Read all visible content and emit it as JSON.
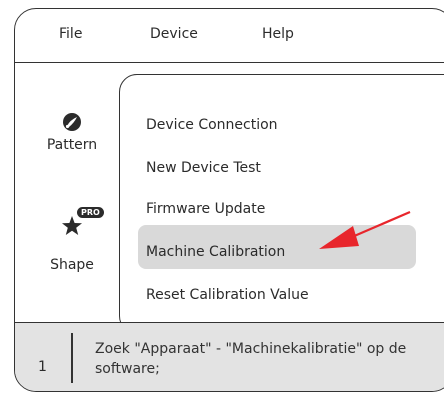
{
  "menubar": {
    "items": [
      "File",
      "Device",
      "Help"
    ]
  },
  "sidebar": {
    "pattern_label": "Pattern",
    "shape_label": "Shape",
    "shape_badge": "PRO",
    "icons": [
      "brush-circle-icon",
      "star-icon"
    ]
  },
  "dropdown": {
    "items": [
      "Device Connection",
      "New Device Test",
      "Firmware Update",
      "Machine Calibration",
      "Reset Calibration Value"
    ],
    "highlighted": "Machine Calibration"
  },
  "annotation": {
    "arrow_color": "#e8262c"
  },
  "step": {
    "number": "1",
    "text": "Zoek \"Apparaat\" - \"Machinekalibratie\" op de software;"
  }
}
